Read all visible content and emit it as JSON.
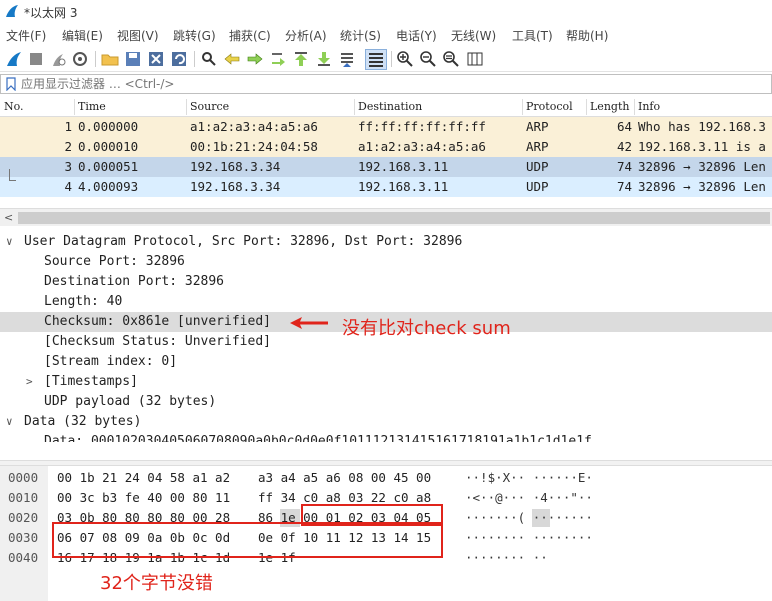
{
  "window": {
    "title": "*以太网 3"
  },
  "menu": [
    "文件(F)",
    "编辑(E)",
    "视图(V)",
    "跳转(G)",
    "捕获(C)",
    "分析(A)",
    "统计(S)",
    "电话(Y)",
    "无线(W)",
    "工具(T)",
    "帮助(H)"
  ],
  "toolbar_icons": [
    "shark-fin-start-icon",
    "stop-icon",
    "restart-icon",
    "options-icon",
    "open-folder-icon",
    "save-icon",
    "close-file-icon",
    "reload-icon",
    "find-icon",
    "back-icon",
    "forward-icon",
    "goto-icon",
    "first-packet-icon",
    "last-packet-icon",
    "autoscroll-icon",
    "colorize-icon",
    "zoom-in-icon",
    "zoom-out-icon",
    "zoom-reset-icon",
    "resize-columns-icon"
  ],
  "filter": {
    "placeholder": "应用显示过滤器 … <Ctrl-/>"
  },
  "packet_list": {
    "columns": [
      "No.",
      "Time",
      "Source",
      "Destination",
      "Protocol",
      "Length",
      "Info"
    ],
    "rows": [
      {
        "no": "1",
        "time": "0.000000",
        "src": "a1:a2:a3:a4:a5:a6",
        "dst": "ff:ff:ff:ff:ff:ff",
        "proto": "ARP",
        "len": "64",
        "info": "Who has 192.168.3"
      },
      {
        "no": "2",
        "time": "0.000010",
        "src": "00:1b:21:24:04:58",
        "dst": "a1:a2:a3:a4:a5:a6",
        "proto": "ARP",
        "len": "42",
        "info": "192.168.3.11 is a"
      },
      {
        "no": "3",
        "time": "0.000051",
        "src": "192.168.3.34",
        "dst": "192.168.3.11",
        "proto": "UDP",
        "len": "74",
        "info": "32896 → 32896 Len"
      },
      {
        "no": "4",
        "time": "4.000093",
        "src": "192.168.3.34",
        "dst": "192.168.3.11",
        "proto": "UDP",
        "len": "74",
        "info": "32896 → 32896 Len"
      }
    ]
  },
  "details": {
    "udp_header": "User Datagram Protocol, Src Port: 32896, Dst Port: 32896",
    "source_port": "Source Port: 32896",
    "destination_port": "Destination Port: 32896",
    "length": "Length: 40",
    "checksum": "Checksum: 0x861e [unverified]",
    "checksum_status": "[Checksum Status: Unverified]",
    "stream_index": "[Stream index: 0]",
    "timestamps": "[Timestamps]",
    "payload": "UDP payload (32 bytes)",
    "data_header": "Data (32 bytes)",
    "data_line": "Data: 000102030405060708090a0b0c0d0e0f101112131415161718191a1b1c1d1e1f"
  },
  "bytes": [
    {
      "offset": "0000",
      "hex_a": "00 1b 21 24 04 58 a1 a2",
      "hex_b": "a3 a4 a5 a6 08 00 45 00",
      "ascii": "··!$·X·· ······E·"
    },
    {
      "offset": "0010",
      "hex_a": "00 3c b3 fe 40 00 80 11",
      "hex_b": "ff 34 c0 a8 03 22 c0 a8",
      "ascii": "·<··@··· ·4···\"··"
    },
    {
      "offset": "0020",
      "hex_a": "03 0b 80 80 80 80 00 28",
      "hex_b": "86 1e 00 01 02 03 04 05",
      "ascii": "·······( ········"
    },
    {
      "offset": "0030",
      "hex_a": "06 07 08 09 0a 0b 0c 0d",
      "hex_b": "0e 0f 10 11 12 13 14 15",
      "ascii": "········ ········"
    },
    {
      "offset": "0040",
      "hex_a": "16 17 18 19 1a 1b 1c 1d",
      "hex_b": "1e 1f",
      "ascii": "········ ··"
    }
  ],
  "annotations": {
    "checksum_note": "没有比对check sum",
    "bytes_note": "32个字节没错"
  },
  "colors": {
    "annotation": "#e0241b",
    "arp_row": "#faf0d7",
    "udp_selected_row": "#c4d6ea",
    "udp_row": "#daeeff"
  }
}
